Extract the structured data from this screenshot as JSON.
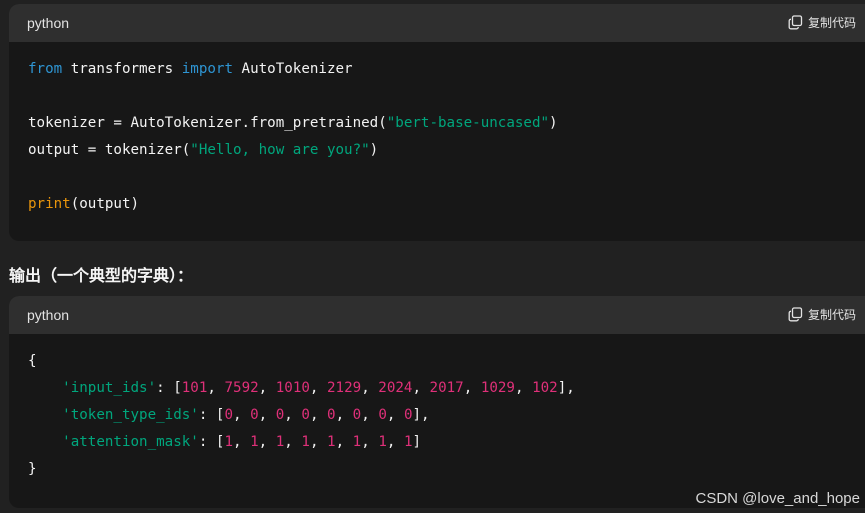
{
  "block1": {
    "language": "python",
    "copy_label": "复制代码",
    "lines": [
      "",
      "",
      "",
      "",
      "",
      "",
      ""
    ],
    "tokens": {
      "from": "from",
      "module": " transformers ",
      "import": "import",
      "class": " AutoTokenizer",
      "tok_assign": "tokenizer = AutoTokenizer.from_pretrained(",
      "model_name": "\"bert-base-uncased\"",
      "tok_close": ")",
      "out_assign": "output = tokenizer(",
      "input_text": "\"Hello, how are you?\"",
      "out_close": ")",
      "print": "print",
      "print_args": "(output)"
    }
  },
  "heading": "输出（一个典型的字典）：",
  "block2": {
    "language": "python",
    "copy_label": "复制代码",
    "open_brace": "{",
    "close_brace": "}",
    "entries": [
      {
        "key": "'input_ids'",
        "values": [
          "101",
          "7592",
          "1010",
          "2129",
          "2024",
          "2017",
          "1029",
          "102"
        ]
      },
      {
        "key": "'token_type_ids'",
        "values": [
          "0",
          "0",
          "0",
          "0",
          "0",
          "0",
          "0",
          "0"
        ]
      },
      {
        "key": "'attention_mask'",
        "values": [
          "1",
          "1",
          "1",
          "1",
          "1",
          "1",
          "1",
          "1"
        ]
      }
    ]
  },
  "watermark": "CSDN @love_and_hope",
  "icons": {
    "copy": "copy-icon"
  },
  "colors": {
    "page_bg": "#212121",
    "code_bg": "#171717",
    "header_bg": "#2f2f2f",
    "keyword": "#2e95d3",
    "string": "#00a67d",
    "number": "#df3079",
    "builtin": "#e9950c"
  }
}
